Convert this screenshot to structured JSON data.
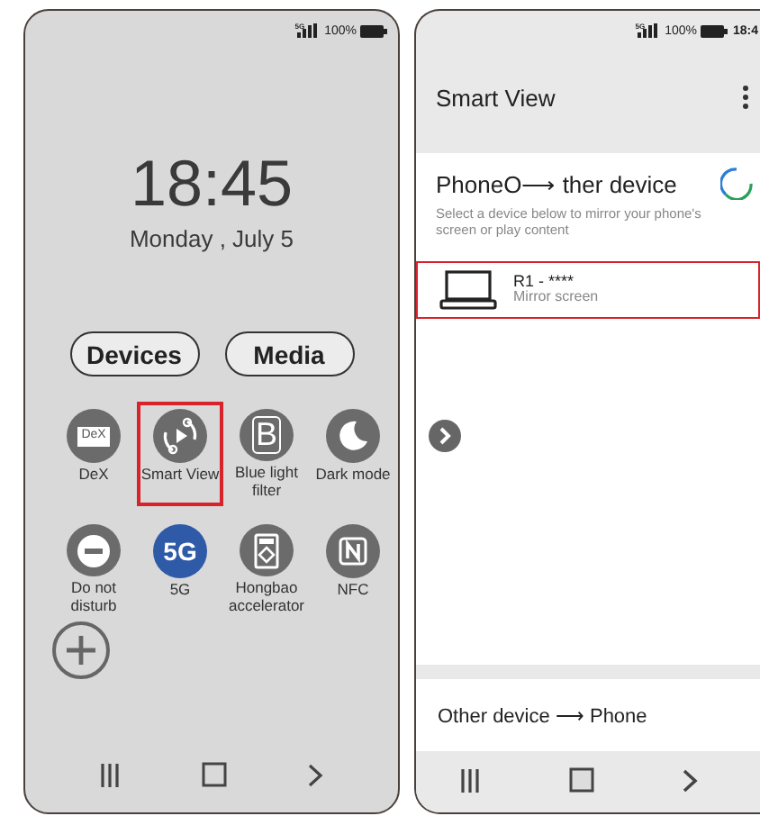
{
  "lock_screen": {
    "status_bar": {
      "network": "5G",
      "battery": "100%"
    },
    "clock": "18:45",
    "date": "Monday , July 5",
    "tabs": [
      {
        "label": "Devices",
        "selected": false
      },
      {
        "label": "Media",
        "selected": false
      }
    ],
    "tiles": [
      {
        "kind": "dex",
        "label": "DeX",
        "icon_text": "DeX",
        "active": false,
        "highlighted": false
      },
      {
        "kind": "smartview",
        "label": "Smart View",
        "active": false,
        "highlighted": true
      },
      {
        "kind": "bluelight",
        "label": "Blue light filter",
        "icon_text": "B",
        "active": false,
        "highlighted": false
      },
      {
        "kind": "darkmode",
        "label": "Dark mode",
        "active": false,
        "highlighted": false
      },
      {
        "kind": "dnd",
        "label": "Do not disturb",
        "active": false,
        "highlighted": false
      },
      {
        "kind": "fiveg",
        "label": "5G",
        "icon_text": "5G",
        "active": true,
        "highlighted": false
      },
      {
        "kind": "hongbao",
        "label": "Hongbao accelerator",
        "active": false,
        "highlighted": false
      },
      {
        "kind": "nfc",
        "label": "NFC",
        "active": false,
        "highlighted": false
      }
    ]
  },
  "smart_view": {
    "status_bar": {
      "network": "5G",
      "battery": "100%",
      "time": "18:4"
    },
    "title": "Smart View",
    "section_title": "PhoneO⟶ ther device",
    "description": "Select a device below to mirror your phone's screen or play content",
    "devices": [
      {
        "name": "R1 - ****",
        "subtitle": "Mirror screen",
        "highlighted": true
      }
    ],
    "other_option": "Other device ⟶ Phone"
  }
}
